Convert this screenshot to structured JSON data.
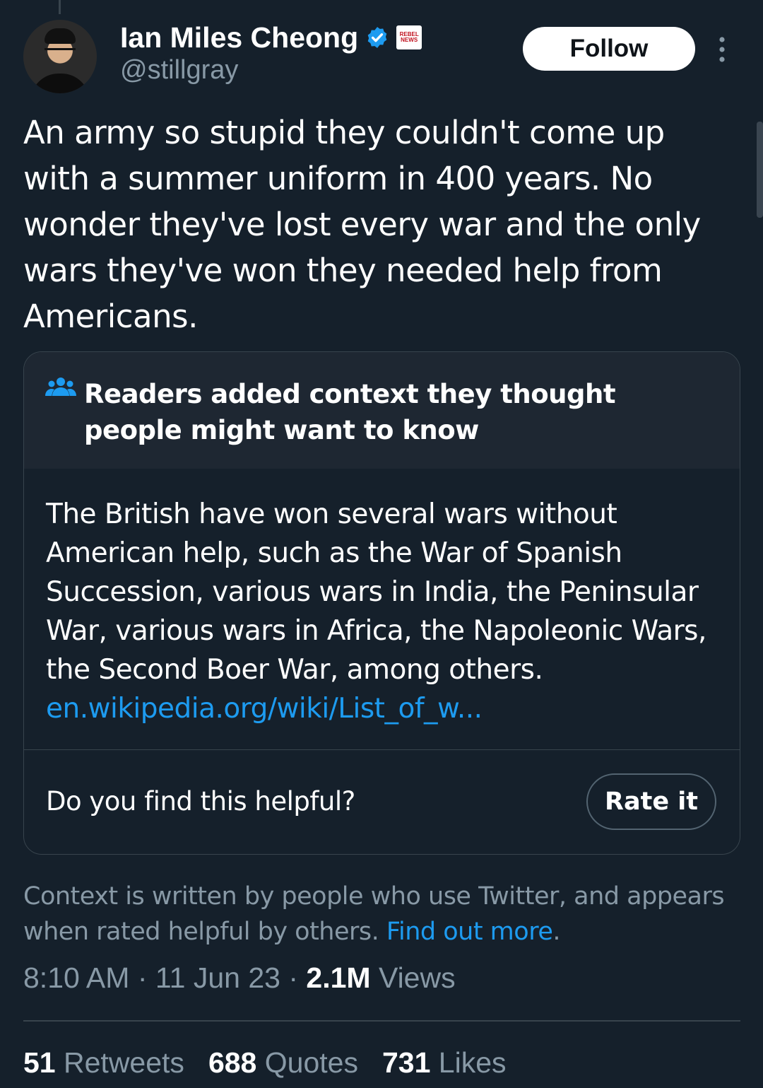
{
  "author": {
    "name": "Ian Miles Cheong",
    "handle": "@stillgray",
    "affiliate_badge_text": "REBEL NEWS"
  },
  "follow_label": "Follow",
  "tweet": {
    "text": "An army so stupid they couldn't come up with a summer uniform in 400 years. No wonder they've lost every war and the only wars they've won they needed help from Americans."
  },
  "community_note": {
    "title": "Readers added context they thought people might want to know",
    "body": "The British have won several wars without American help, such as the War of Spanish Succession, various wars in India, the Peninsular War, various wars in Africa, the Napoleonic Wars, the Second Boer War, among others.",
    "link": "en.wikipedia.org/wiki/List_of_w...",
    "helpful_question": "Do you find this helpful?",
    "rate_label": "Rate it"
  },
  "context_footer": {
    "text": "Context is written by people who use Twitter, and appears when rated helpful by others.",
    "link_label": "Find out more",
    "suffix": "."
  },
  "meta": {
    "time": "8:10 AM",
    "date": "11 Jun 23",
    "views_count": "2.1M",
    "views_label": "Views"
  },
  "stats": [
    {
      "count": "51",
      "label": "Retweets"
    },
    {
      "count": "688",
      "label": "Quotes"
    },
    {
      "count": "731",
      "label": "Likes"
    }
  ],
  "colors": {
    "background": "#15202b",
    "accent": "#1d9bf0",
    "muted_text": "#8899a6",
    "note_header": "#1e2732"
  }
}
